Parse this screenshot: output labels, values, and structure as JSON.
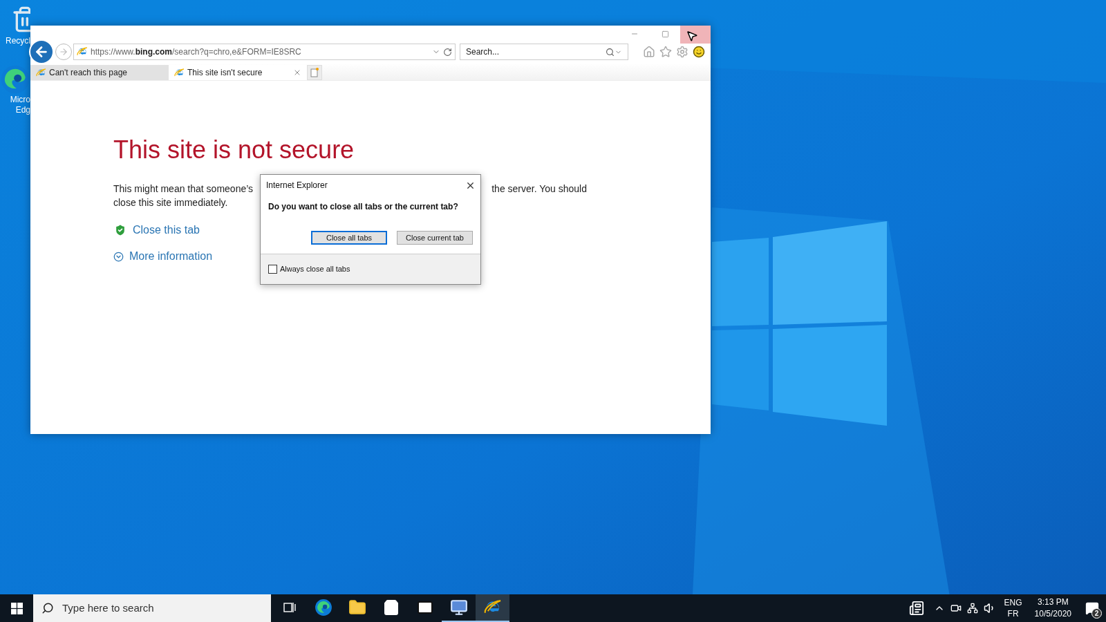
{
  "desktop_icons": [
    {
      "kind": "recycle",
      "lines": [
        "Recycl"
      ]
    },
    {
      "kind": "edge",
      "lines": [
        "Micro",
        "Edg"
      ]
    }
  ],
  "browser": {
    "close_hovered": true,
    "address": "https://www.**bing.com**/search?q=chro,e&FORM=IE8SRC",
    "search": {
      "placeholder": "Search..."
    },
    "tabs": [
      {
        "label": "Can't reach this page",
        "selected": false
      },
      {
        "label": "This site isn't secure",
        "selected": true
      }
    ],
    "page": {
      "heading": "This site is not secure",
      "line_1_left": "This might mean that someone’s",
      "line_1_right": "the server. You should",
      "line_2": "close this site immediately.",
      "links": [
        {
          "kind": "shield",
          "label": "Close this tab"
        },
        {
          "kind": "expand",
          "label": "More information"
        }
      ]
    }
  },
  "dialog": {
    "title": "Internet Explorer",
    "question": "Do you want to close all tabs or the current tab?",
    "buttons": [
      {
        "label": "Close all tabs",
        "default": true
      },
      {
        "label": "Close current tab",
        "default": false
      }
    ],
    "checkbox": {
      "label": "Always close all tabs",
      "checked": false
    }
  },
  "taskbar": {
    "search": {
      "placeholder": "Type here to search"
    },
    "apps": [
      {
        "kind": "task-view",
        "selected": false,
        "running": false
      },
      {
        "kind": "edge",
        "selected": false,
        "running": false
      },
      {
        "kind": "folder",
        "selected": false,
        "running": false
      },
      {
        "kind": "store",
        "selected": false,
        "running": false
      },
      {
        "kind": "mail",
        "selected": false,
        "running": false
      },
      {
        "kind": "remote",
        "selected": false,
        "running": true
      },
      {
        "kind": "ie",
        "selected": true,
        "running": true
      }
    ],
    "language": [
      "ENG",
      "FR"
    ],
    "time": "3:13 PM",
    "date": "10/5/2020",
    "notifications": "2"
  }
}
